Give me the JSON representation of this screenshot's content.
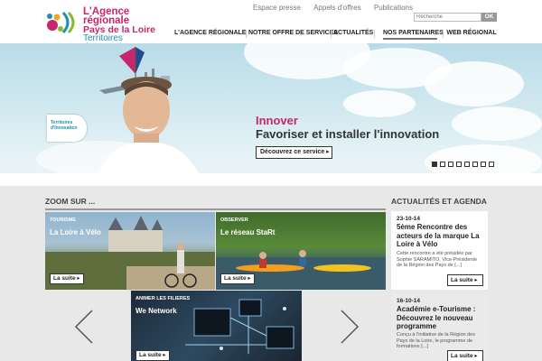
{
  "header": {
    "logo": {
      "line1": "L'Agence régionale",
      "line2": "Pays de la Loire",
      "line3": "Territoires d'Innovation"
    },
    "top_links": [
      "Espace presse",
      "Appels d'offres",
      "Publications"
    ],
    "search": {
      "placeholder": "Recherche",
      "button": "OK"
    },
    "nav": [
      "L'AGENCE RÉGIONALE",
      "NOTRE OFFRE DE SERVICES",
      "ACTUALITÉS",
      "NOS PARTENAIRES",
      "WEB RÉGIONAL"
    ],
    "nav_active_index": 3
  },
  "banner": {
    "badge_line1": "Territoires",
    "badge_line2": "d'Innovation",
    "title": "Innover",
    "subtitle": "Favoriser et installer l'innovation",
    "button": "Découvrez ce service ▸",
    "slide_count": 8,
    "active_slide_index": 0
  },
  "zoom": {
    "title": "ZOOM SUR ...",
    "tiles": [
      {
        "tag": "TOURISME",
        "title": "La Loire à Vélo",
        "button": "La suite ▸"
      },
      {
        "tag": "OBSERVER",
        "title": "Le réseau StaRt",
        "button": "La suite ▸"
      },
      {
        "tag": "ANIMER LES FILIERES",
        "title": "We Network",
        "button": "La suite ▸"
      }
    ]
  },
  "agenda": {
    "title": "ACTUALITÉS ET AGENDA",
    "items": [
      {
        "date": "23-10-14",
        "title": "5ème Rencontre des acteurs de la marque La Loire à Vélo",
        "text": "Cette rencontre a été présidée par Sophie SARAMITO, Vice-Présidente de la Région des Pays de [...]",
        "button": "La suite ▸"
      },
      {
        "date": "16-10-14",
        "title": "Académie e-Tourisme : Découvrez le nouveau programme",
        "text": "Conçu à l'initiative de la Région des Pays de la Loire, le programme de formations [...]",
        "button": "La suite ▸"
      }
    ]
  },
  "colors": {
    "brand_pink": "#c8266b",
    "brand_blue": "#1e8fb0",
    "background_gray": "#e8e8e8"
  }
}
